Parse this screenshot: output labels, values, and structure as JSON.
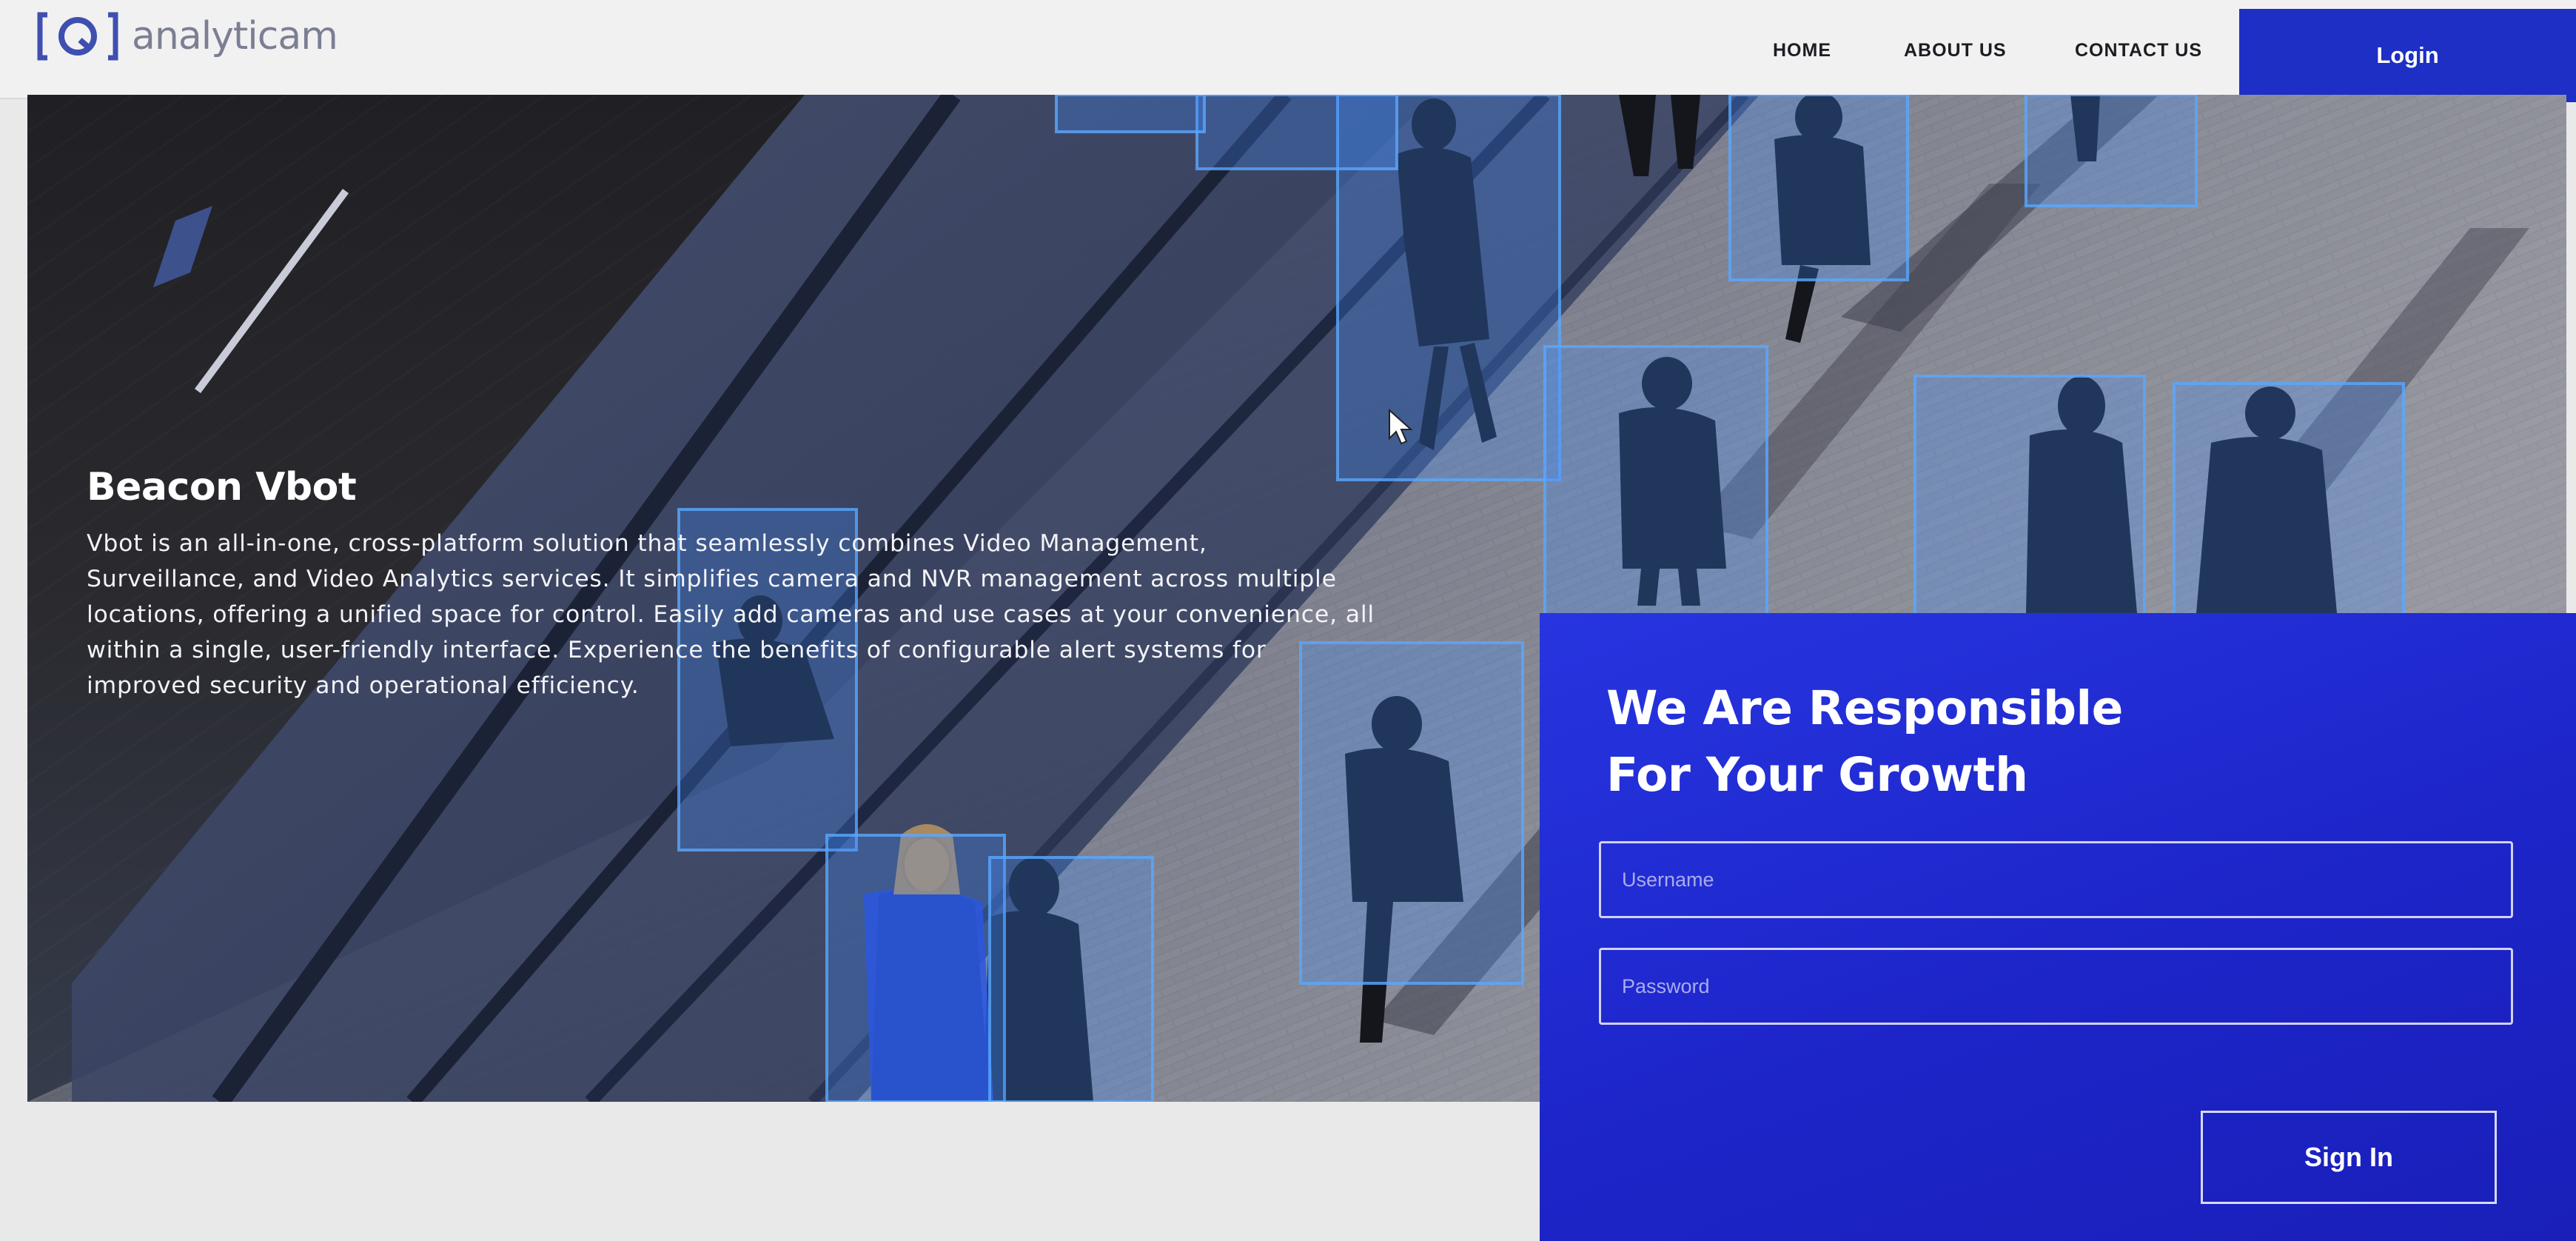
{
  "brand": {
    "name": "analyticam",
    "logo_icon": "camera-lens-bracket-icon"
  },
  "nav": {
    "links": [
      {
        "label": "HOME"
      },
      {
        "label": "ABOUT US"
      },
      {
        "label": "CONTACT US"
      }
    ],
    "login_label": "Login"
  },
  "hero": {
    "title": "Beacon Vbot",
    "description_lines": [
      "Vbot is an all-in-one, cross-platform solution that seamlessly combines Video Management,",
      "Surveillance, and Video Analytics services. It simplifies camera and NVR management across multiple",
      "locations, offering a unified space for control. Easily add cameras and use cases at your convenience, all",
      "within a single, user-friendly interface. Experience the benefits of configurable alert systems for",
      "improved security and operational efficiency."
    ]
  },
  "login_panel": {
    "heading_line1": "We Are Responsible",
    "heading_line2": "For Your Growth",
    "username_placeholder": "Username",
    "password_placeholder": "Password",
    "submit_label": "Sign In"
  },
  "colors": {
    "accent_blue": "#1d2fc4",
    "panel_blue": "#2233d6",
    "detection_box": "#3a8cff",
    "nav_bg": "#f1f1f2"
  }
}
